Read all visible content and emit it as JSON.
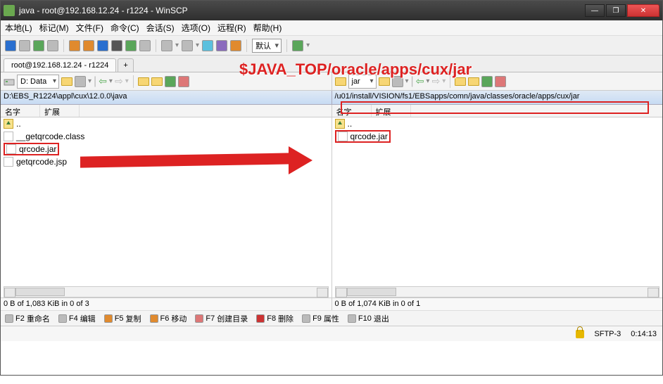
{
  "title": "java - root@192.168.12.24 - r1224 - WinSCP",
  "menu": [
    "本地(L)",
    "标记(M)",
    "文件(F)",
    "命令(C)",
    "会话(S)",
    "选项(O)",
    "远程(R)",
    "帮助(H)"
  ],
  "combo_default": "默认",
  "session_tab": "root@192.168.12.24 - r1224",
  "plus_tab": "+",
  "left_drive": "D: Data",
  "right_drive": "jar",
  "left_path": "D:\\EBS_R1224\\appl\\cux\\12.0.0\\java",
  "right_path": "/u01/install/VISION/fs1/EBSapps/comn/java/classes/oracle/apps/cux/jar",
  "col_name": "名字",
  "col_ext": "扩展",
  "updir": "..",
  "left_files": [
    "__getqrcode.class",
    "qrcode.jar",
    "getqrcode.jsp"
  ],
  "right_files": [
    "qrcode.jar"
  ],
  "left_status": "0 B of 1,083 KiB in 0 of 3",
  "right_status": "0 B of 1,074 KiB in 0 of 1",
  "fkeys": [
    {
      "k": "F2",
      "t": "重命名"
    },
    {
      "k": "F4",
      "t": "编辑"
    },
    {
      "k": "F5",
      "t": "复制"
    },
    {
      "k": "F6",
      "t": "移动"
    },
    {
      "k": "F7",
      "t": "创建目录"
    },
    {
      "k": "F8",
      "t": "删除"
    },
    {
      "k": "F9",
      "t": "属性"
    },
    {
      "k": "F10",
      "t": "退出"
    }
  ],
  "proto": "SFTP-3",
  "elapsed": "0:14:13",
  "annotation": "$JAVA_TOP/oracle/apps/cux/jar"
}
